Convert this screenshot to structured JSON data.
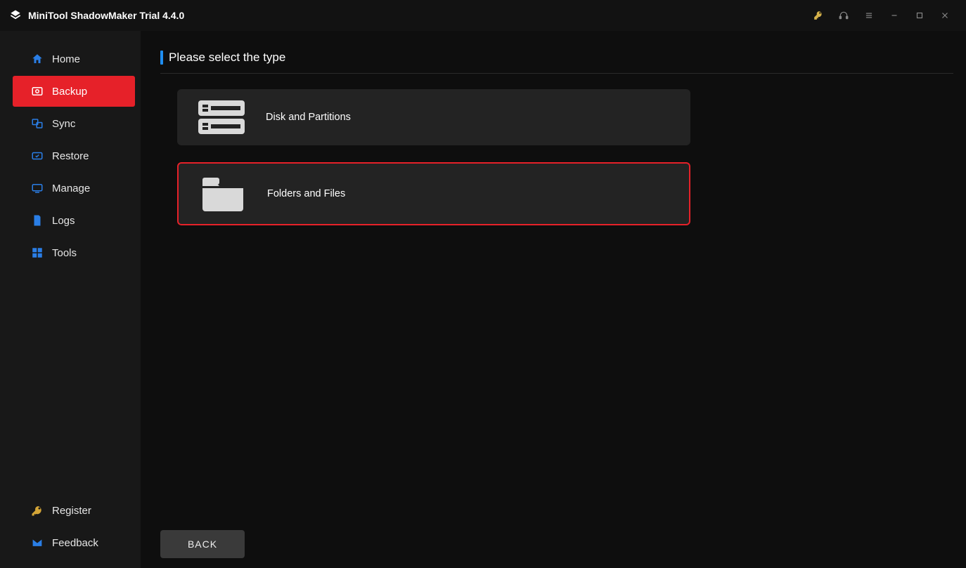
{
  "titlebar": {
    "app_title": "MiniTool ShadowMaker Trial 4.4.0"
  },
  "sidebar": {
    "items": [
      {
        "label": "Home",
        "icon": "home-icon",
        "active": false
      },
      {
        "label": "Backup",
        "icon": "backup-icon",
        "active": true
      },
      {
        "label": "Sync",
        "icon": "sync-icon",
        "active": false
      },
      {
        "label": "Restore",
        "icon": "restore-icon",
        "active": false
      },
      {
        "label": "Manage",
        "icon": "manage-icon",
        "active": false
      },
      {
        "label": "Logs",
        "icon": "logs-icon",
        "active": false
      },
      {
        "label": "Tools",
        "icon": "tools-icon",
        "active": false
      }
    ],
    "bottom": [
      {
        "label": "Register",
        "icon": "key-icon"
      },
      {
        "label": "Feedback",
        "icon": "mail-icon"
      }
    ]
  },
  "main": {
    "header": "Please select the type",
    "options": [
      {
        "label": "Disk and Partitions",
        "highlighted": false
      },
      {
        "label": "Folders and Files",
        "highlighted": true
      }
    ],
    "back_label": "BACK"
  }
}
